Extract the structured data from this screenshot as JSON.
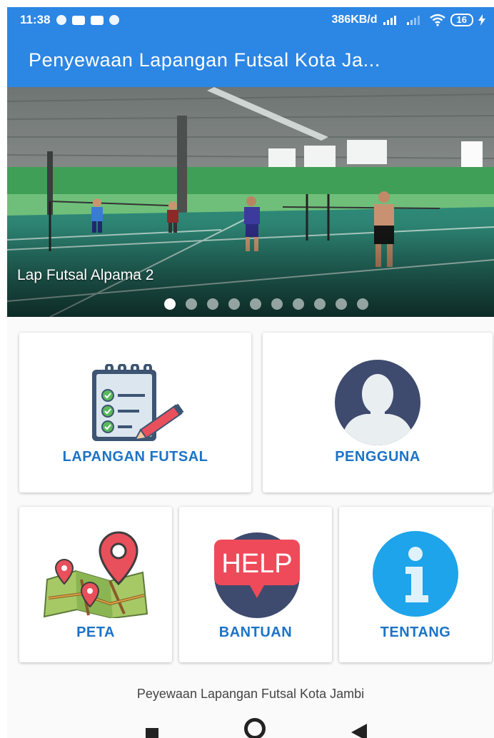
{
  "status_bar": {
    "time": "11:38",
    "speed": "386KB/d",
    "battery": "16"
  },
  "app_bar": {
    "title": "Penyewaan Lapangan Futsal Kota Ja..."
  },
  "slider": {
    "caption": "Lap Futsal Alpama 2",
    "dot_count": 10,
    "active_index": 0
  },
  "menu": {
    "lapangan_label": "LAPANGAN FUTSAL",
    "pengguna_label": "PENGGUNA",
    "peta_label": "PETA",
    "bantuan_label": "BANTUAN",
    "help_text": "HELP",
    "tentang_label": "TENTANG"
  },
  "footer": {
    "text": "Peyewaan Lapangan Futsal Kota Jambi"
  },
  "colors": {
    "primary": "#2c86e4",
    "label": "#1c73c7"
  },
  "icons": [
    "wifi-icon",
    "signal-icon",
    "battery-icon",
    "clipboard-checklist-icon",
    "user-avatar-icon",
    "map-pin-icon",
    "help-bubble-icon",
    "info-icon",
    "recent-apps-icon",
    "home-icon",
    "back-icon"
  ]
}
